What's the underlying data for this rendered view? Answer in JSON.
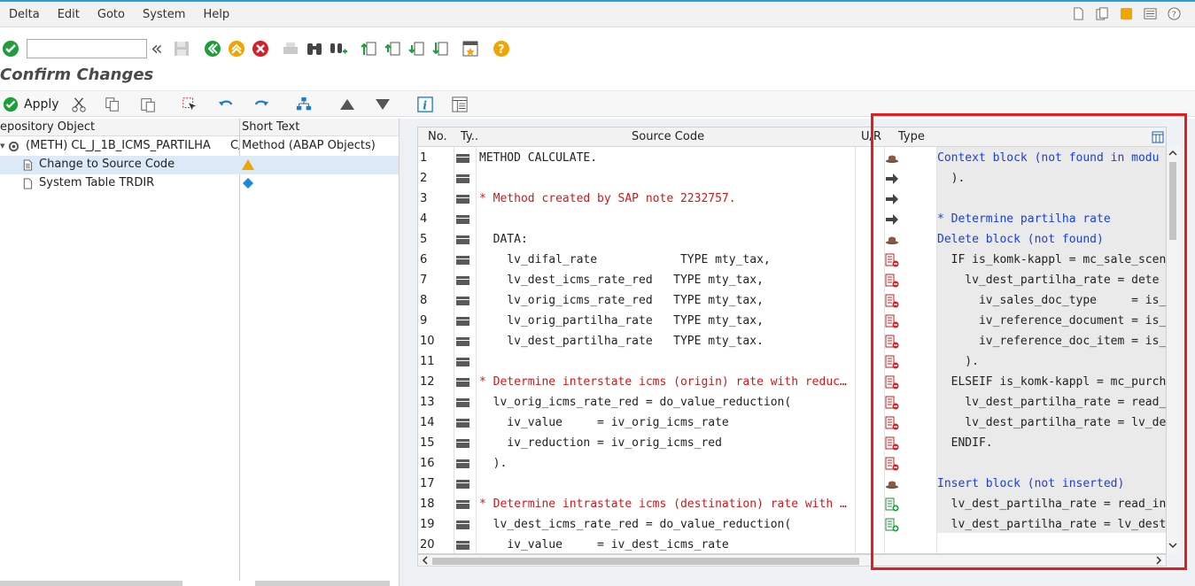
{
  "menu": [
    "Delta",
    "Edit",
    "Goto",
    "System",
    "Help"
  ],
  "command_field": {
    "value": ""
  },
  "title": "Confirm Changes",
  "toolbar2": {
    "apply_label": "Apply"
  },
  "tree": {
    "header_col1": "epository Object",
    "header_col2": "Short Text",
    "rows": [
      {
        "label": "(METH)  CL_J_1B_ICMS_PARTILHA",
        "col1_extra": "C/",
        "short_text": "Method (ABAP Objects)"
      },
      {
        "label": "Change to Source Code",
        "short_text": ""
      },
      {
        "label": "System Table TRDIR",
        "short_text": ""
      }
    ]
  },
  "grid": {
    "headers": {
      "no": "No.",
      "ty": "Ty..",
      "source": "Source Code",
      "ur": "U/R",
      "type": "Type"
    },
    "rows": [
      {
        "no": "1",
        "src": "METHOD CALCULATE.",
        "src_color": "black",
        "icon": "hat-icon",
        "right": "Context block (not found in modu",
        "right_color": "blue"
      },
      {
        "no": "2",
        "src": "",
        "src_color": "black",
        "icon": "arrow-icon",
        "right": "  ).",
        "right_color": "black"
      },
      {
        "no": "3",
        "src": "* Method created by SAP note 2232757.",
        "src_color": "red",
        "icon": "arrow-icon",
        "right": "",
        "right_color": "black"
      },
      {
        "no": "4",
        "src": "",
        "src_color": "black",
        "icon": "arrow-icon",
        "right": "* Determine partilha rate",
        "right_color": "blue"
      },
      {
        "no": "5",
        "src": "  DATA:",
        "src_color": "black",
        "icon": "hat-icon",
        "right": "Delete block (not found)",
        "right_color": "blue"
      },
      {
        "no": "6",
        "src": "    lv_difal_rate            TYPE mty_tax,",
        "src_color": "black",
        "icon": "delete-line-icon",
        "right": "  IF is_komk-kappl = mc_sale_scen",
        "right_color": "black"
      },
      {
        "no": "7",
        "src": "    lv_dest_icms_rate_red   TYPE mty_tax,",
        "src_color": "black",
        "icon": "delete-line-icon",
        "right": "    lv_dest_partilha_rate = dete",
        "right_color": "black"
      },
      {
        "no": "8",
        "src": "    lv_orig_icms_rate_red   TYPE mty_tax,",
        "src_color": "black",
        "icon": "delete-line-icon",
        "right": "      iv_sales_doc_type     = is_",
        "right_color": "black"
      },
      {
        "no": "9",
        "src": "    lv_orig_partilha_rate   TYPE mty_tax,",
        "src_color": "black",
        "icon": "delete-line-icon",
        "right": "      iv_reference_document = is_",
        "right_color": "black"
      },
      {
        "no": "10",
        "src": "    lv_dest_partilha_rate   TYPE mty_tax.",
        "src_color": "black",
        "icon": "delete-line-icon",
        "right": "      iv_reference_doc_item = is_",
        "right_color": "black"
      },
      {
        "no": "11",
        "src": "",
        "src_color": "black",
        "icon": "delete-line-icon",
        "right": "    ).",
        "right_color": "black"
      },
      {
        "no": "12",
        "src": "* Determine interstate icms (origin) rate with reduc…",
        "src_color": "red",
        "icon": "delete-line-icon",
        "right": "  ELSEIF is_komk-kappl = mc_purch",
        "right_color": "black"
      },
      {
        "no": "13",
        "src": "  lv_orig_icms_rate_red = do_value_reduction(",
        "src_color": "black",
        "icon": "delete-line-icon",
        "right": "    lv_dest_partilha_rate = read_",
        "right_color": "black"
      },
      {
        "no": "14",
        "src": "    iv_value     = iv_orig_icms_rate",
        "src_color": "black",
        "icon": "delete-line-icon",
        "right": "    lv_dest_partilha_rate = lv_de",
        "right_color": "black"
      },
      {
        "no": "15",
        "src": "    iv_reduction = iv_orig_icms_red",
        "src_color": "black",
        "icon": "delete-line-icon",
        "right": "  ENDIF.",
        "right_color": "black"
      },
      {
        "no": "16",
        "src": "  ).",
        "src_color": "black",
        "icon": "delete-line-icon",
        "right": "",
        "right_color": "black"
      },
      {
        "no": "17",
        "src": "",
        "src_color": "black",
        "icon": "hat-icon",
        "right": "Insert block (not inserted)",
        "right_color": "blue"
      },
      {
        "no": "18",
        "src": "* Determine intrastate icms (destination) rate with …",
        "src_color": "red",
        "icon": "insert-line-icon",
        "right": "  lv_dest_partilha_rate = read_in",
        "right_color": "black"
      },
      {
        "no": "19",
        "src": "  lv_dest_icms_rate_red = do_value_reduction(",
        "src_color": "black",
        "icon": "insert-line-icon",
        "right": "  lv_dest_partilha_rate = lv_dest",
        "right_color": "black"
      },
      {
        "no": "20",
        "src": "    iv_value     = iv_dest_icms_rate",
        "src_color": "black",
        "icon": "",
        "right": "",
        "right_color": "black"
      }
    ]
  },
  "colors": {
    "accent_red": "#e02020",
    "code_red": "#d0181b",
    "code_blue": "#1a3fd9",
    "green": "#1e9e3a",
    "orange": "#f0a500"
  }
}
